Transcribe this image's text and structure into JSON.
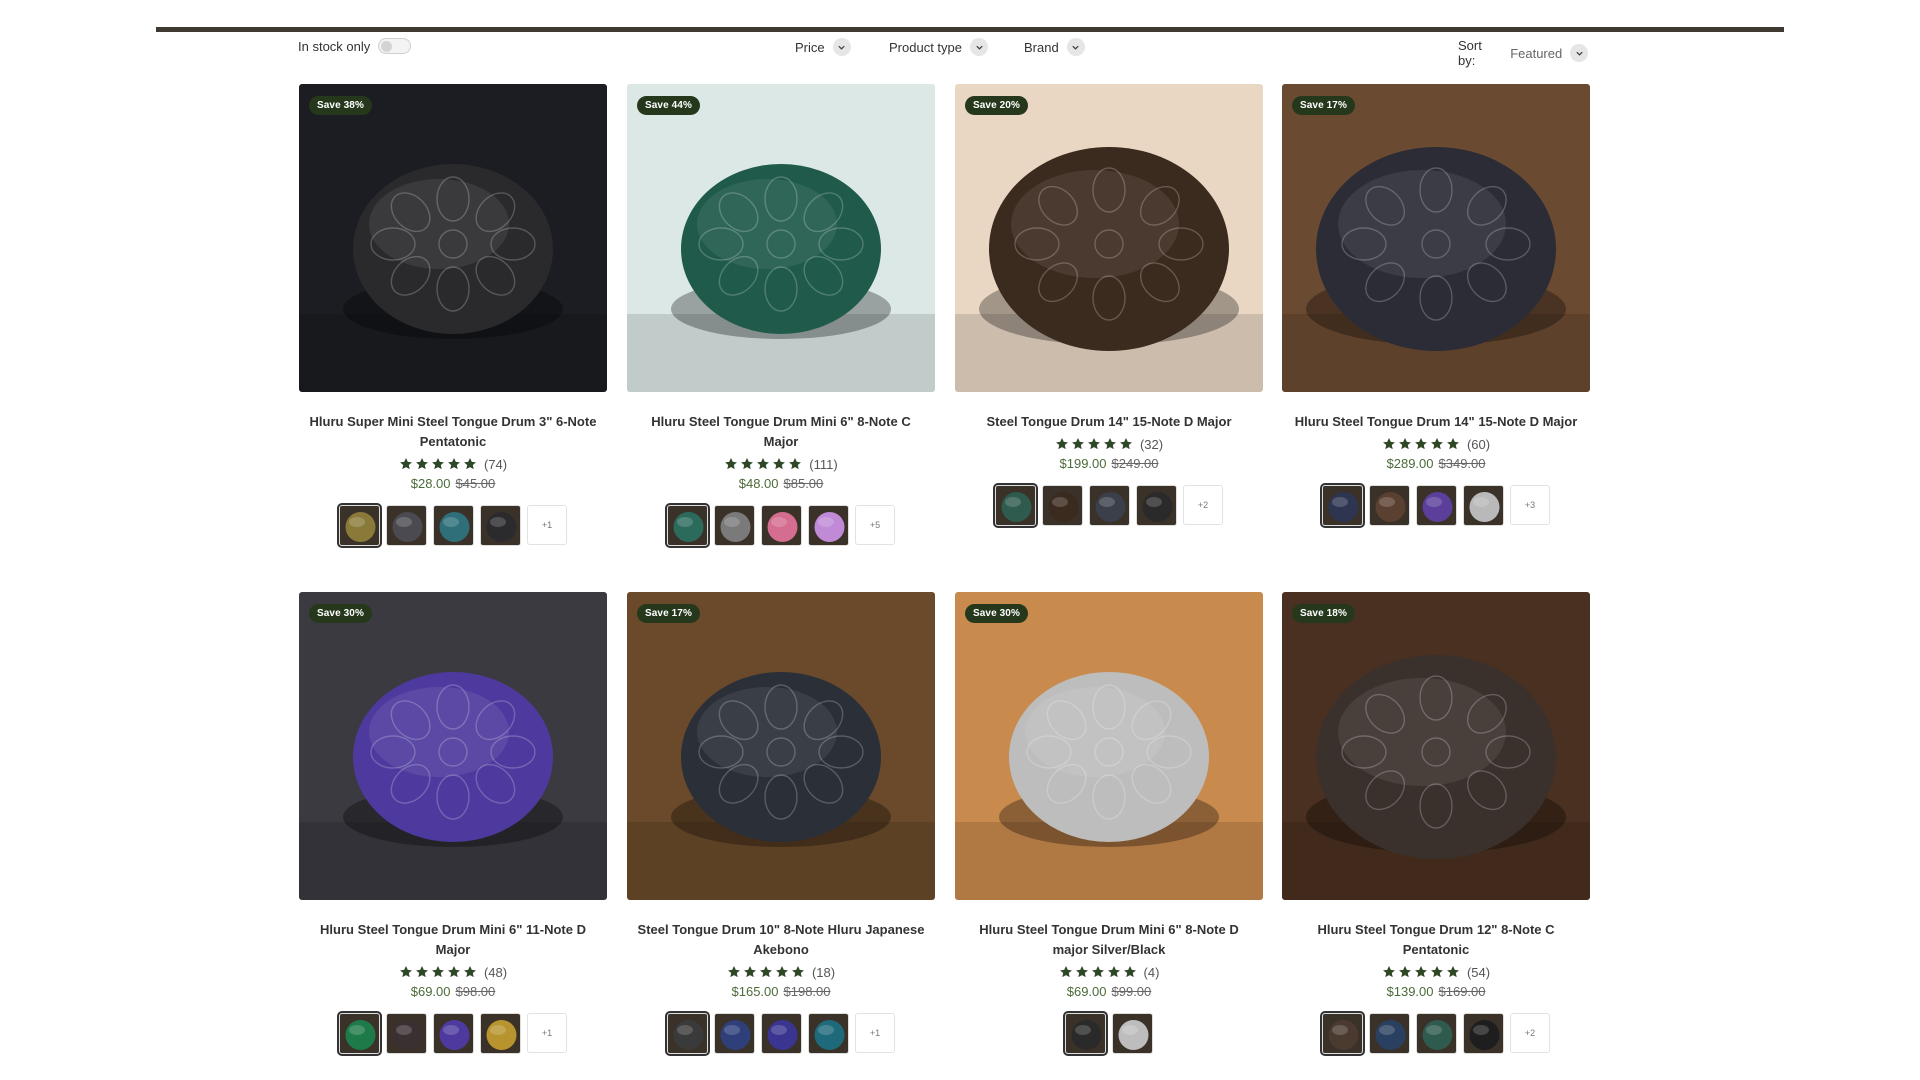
{
  "filters": {
    "in_stock": "In stock only",
    "price": "Price",
    "product_type": "Product type",
    "brand": "Brand",
    "sort_label": "Sort by:",
    "sort_value": "Featured"
  },
  "colors": {
    "badge": "#26381c",
    "star": "#2e4724",
    "price": "#4b6b3a",
    "rule": "#3e3a32"
  },
  "products": [
    {
      "badge": "Save 38%",
      "title": "Hluru Super Mini Steel Tongue Drum 3\" 6-Note Pentatonic",
      "rating": 5,
      "reviews": "(74)",
      "price": "$28.00",
      "compare": "$45.00",
      "more": "+1",
      "image_bg": "#1b1d22",
      "drum": "#2a2a2d",
      "swatches": [
        "#8a7a3a",
        "#4a4a50",
        "#2e6f7a",
        "#2b2b2e"
      ]
    },
    {
      "badge": "Save 44%",
      "title": "Hluru Steel Tongue Drum Mini 6\" 8-Note C Major",
      "rating": 5,
      "reviews": "(111)",
      "price": "$48.00",
      "compare": "$85.00",
      "more": "+5",
      "image_bg": "#dce8e6",
      "drum": "#1f5a4a",
      "swatches": [
        "#2c6b5c",
        "#7a7a7a",
        "#d46d8f",
        "#c08ad6"
      ]
    },
    {
      "badge": "Save 20%",
      "title": "Steel Tongue Drum 14\" 15-Note D Major",
      "rating": 5,
      "reviews": "(32)",
      "price": "$199.00",
      "compare": "$249.00",
      "more": "+2",
      "image_bg": "#e9d7c4",
      "drum": "#3b2a1e",
      "swatches": [
        "#2f5a4e",
        "#3b2a1e",
        "#3a3f4a",
        "#2a2a2a"
      ]
    },
    {
      "badge": "Save 17%",
      "title": "Hluru Steel Tongue Drum 14\" 15-Note D Major",
      "rating": 5,
      "reviews": "(60)",
      "price": "$289.00",
      "compare": "$349.00",
      "more": "+3",
      "image_bg": "#6b4a32",
      "drum": "#2b2c36",
      "swatches": [
        "#2e3550",
        "#5a4030",
        "#5b3f9a",
        "#b9b9b9"
      ]
    },
    {
      "badge": "Save 30%",
      "title": "Hluru Steel Tongue Drum Mini 6\" 11-Note D Major",
      "rating": 5,
      "reviews": "(48)",
      "price": "$69.00",
      "compare": "$98.00",
      "more": "+1",
      "image_bg": "#3a3a40",
      "drum": "#4e3a9e",
      "swatches": [
        "#1f7a4a",
        "#3a3032",
        "#4e3a9e",
        "#b8942e"
      ]
    },
    {
      "badge": "Save 17%",
      "title": "Steel Tongue Drum 10\" 8-Note Hluru Japanese Akebono",
      "rating": 5,
      "reviews": "(18)",
      "price": "$165.00",
      "compare": "$198.00",
      "more": "+1",
      "image_bg": "#6a4a2a",
      "drum": "#2a2f38",
      "swatches": [
        "#3a3a3a",
        "#2e3f7a",
        "#3a3590",
        "#1f6a7a"
      ]
    },
    {
      "badge": "Save 30%",
      "title": "Hluru Steel Tongue Drum Mini 6\" 8-Note D major Silver/Black",
      "rating": 5,
      "reviews": "(4)",
      "price": "$69.00",
      "compare": "$99.00",
      "more": "",
      "image_bg": "#c98a4e",
      "drum": "#bdbdbd",
      "swatches": [
        "#2a2a2a",
        "#bdbdbd"
      ]
    },
    {
      "badge": "Save 18%",
      "title": "Hluru Steel Tongue Drum 12\" 8-Note C Pentatonic",
      "rating": 5,
      "reviews": "(54)",
      "price": "$139.00",
      "compare": "$169.00",
      "more": "+2",
      "image_bg": "#4a3020",
      "drum": "#3a302c",
      "swatches": [
        "#4a3a30",
        "#2a4060",
        "#2f5a4e",
        "#1e1e1e"
      ]
    }
  ]
}
